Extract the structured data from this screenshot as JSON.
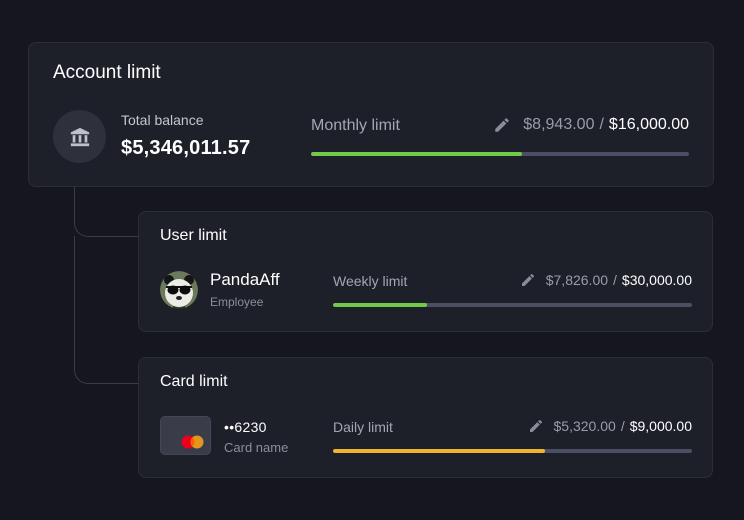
{
  "account": {
    "title": "Account limit",
    "balance_label": "Total balance",
    "balance_value": "$5,346,011.57",
    "limit_label": "Monthly limit",
    "used": "$8,943.00",
    "separator": "/",
    "total": "$16,000.00",
    "progress": 0.5589,
    "bar_color": "#72c94a",
    "icon": "bank-icon"
  },
  "user": {
    "title": "User limit",
    "name": "PandaAff",
    "role": "Employee",
    "limit_label": "Weekly limit",
    "used": "$7,826.00",
    "separator": "/",
    "total": "$30,000.00",
    "progress": 0.2609,
    "bar_color": "#72c94a",
    "icon": "panda-avatar"
  },
  "card": {
    "title": "Card limit",
    "number": "••6230",
    "name": "Card name",
    "limit_label": "Daily limit",
    "used": "$5,320.00",
    "separator": "/",
    "total": "$9,000.00",
    "progress": 0.5911,
    "bar_color": "#f0b52e",
    "icon": "mastercard-icon"
  },
  "colors": {
    "background": "#15161e",
    "card_bg": "#1d1f29",
    "bar_track": "#4c4e63"
  }
}
